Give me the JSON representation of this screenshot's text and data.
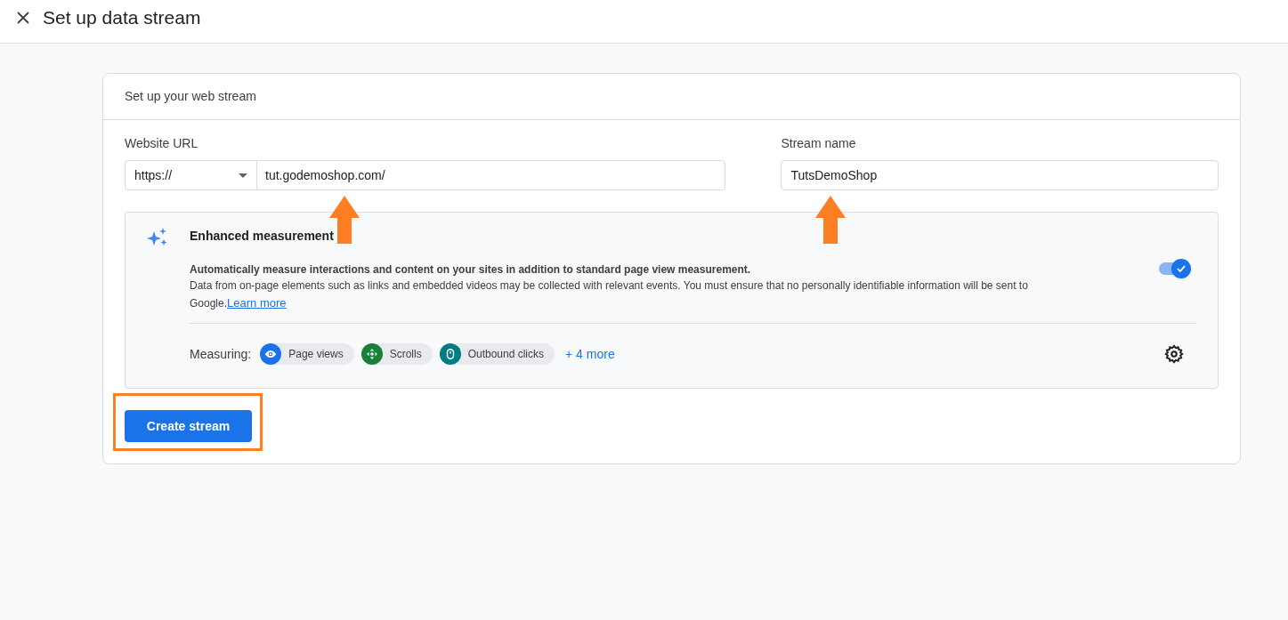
{
  "header": {
    "title": "Set up data stream"
  },
  "card": {
    "title": "Set up your web stream",
    "website_url": {
      "label": "Website URL",
      "protocol": "https://",
      "value": "tut.godemoshop.com/"
    },
    "stream_name": {
      "label": "Stream name",
      "value": "TutsDemoShop"
    },
    "enhanced_measurement": {
      "title": "Enhanced measurement",
      "on": true,
      "description": "Automatically measure interactions and content on your sites in addition to standard page view measurement.",
      "note": "Data from on-page elements such as links and embedded videos may be collected with relevant events. You must ensure that no personally identifiable information will be sent to Google.",
      "link": "Learn more",
      "measuring_label": "Measuring:",
      "chips": [
        {
          "label": "Page views",
          "color": "#1a73e8"
        },
        {
          "label": "Scrolls",
          "color": "#188038"
        },
        {
          "label": "Outbound clicks",
          "color": "#007b83"
        }
      ],
      "more": "+ 4 more"
    },
    "button": "Create stream"
  }
}
